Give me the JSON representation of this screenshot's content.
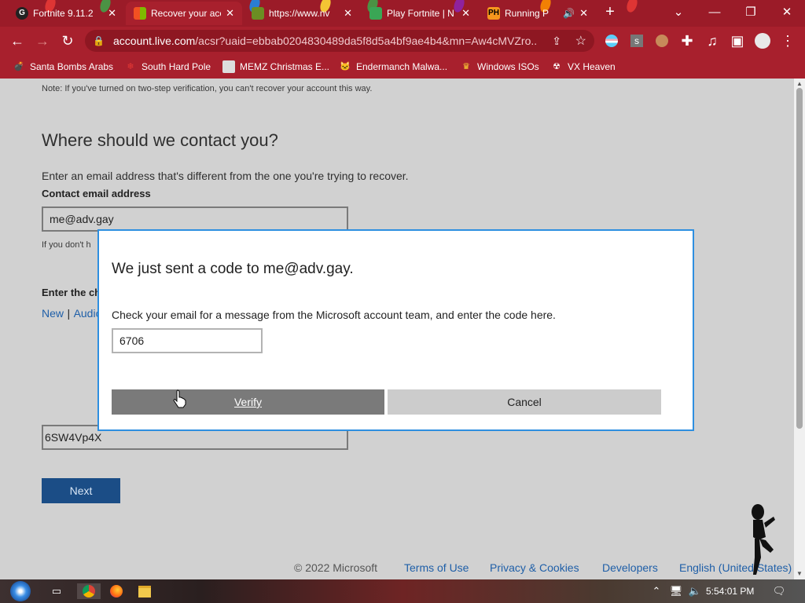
{
  "browser": {
    "tabs": [
      {
        "label": "Fortnite 9.11.2",
        "favicon": "G",
        "favicon_color": "#222222",
        "active": false
      },
      {
        "label": "Recover your account",
        "favicon": "",
        "favicon_color": "#f25022",
        "active": true
      },
      {
        "label": "https://www.nv",
        "favicon": "",
        "favicon_color": "#6b8e23",
        "active": false
      },
      {
        "label": "Play Fortnite | N",
        "favicon": "",
        "favicon_color": "#3aa655",
        "active": false
      },
      {
        "label": "Running P",
        "favicon": "PH",
        "favicon_color": "#f7971d",
        "active": false
      }
    ],
    "url_host": "account.live.com",
    "url_path": "/acsr?uaid=ebbab0204830489da5f8d5a4bf9ae4b4&mn=Aw4cMVZro...",
    "bookmarks": [
      "Santa Bombs Arabs",
      "South Hard Pole",
      "MEMZ Christmas E...",
      "Endermanch Malwa...",
      "Windows ISOs",
      "VX Heaven"
    ]
  },
  "page": {
    "note": "Note: If you've turned on two-step verification, you can't recover your account this way.",
    "heading": "Where should we contact you?",
    "subtext": "Enter an email address that's different from the one you're trying to recover.",
    "contact_label": "Contact email address",
    "contact_value": "me@adv.gay",
    "hint_partial": "If you don't h",
    "captcha_label_partial": "Enter the ch",
    "captcha_new": "New",
    "captcha_sep": "|",
    "captcha_audio_partial": "Audio",
    "captcha_value": "6SW4Vp4X",
    "next_label": "Next"
  },
  "modal": {
    "title": "We just sent a code to me@adv.gay.",
    "text": "Check your email for a message from the Microsoft account team, and enter the code here.",
    "code_value": "6706",
    "verify_label": "Verify",
    "cancel_label": "Cancel"
  },
  "footer": {
    "copyright": "© 2022 Microsoft",
    "terms": "Terms of Use",
    "privacy": "Privacy & Cookies",
    "developers": "Developers",
    "language": "English (United States)"
  },
  "taskbar": {
    "clock": "5:54:01 PM"
  },
  "colors": {
    "chrome": "#a8202d",
    "modal_border": "#2e8fe0",
    "primary_button": "#1b4d86",
    "link": "#1f5fa8"
  }
}
